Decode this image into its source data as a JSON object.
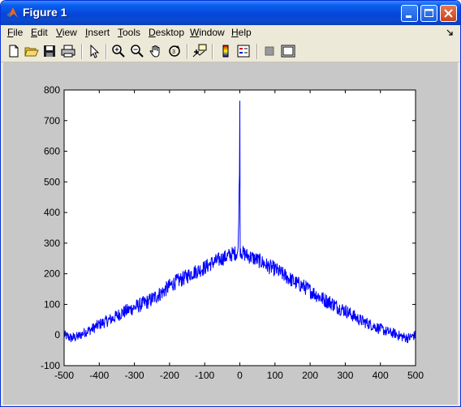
{
  "window": {
    "title": "Figure 1"
  },
  "menu": {
    "items": [
      {
        "key": "file",
        "label": "File",
        "accel": "F",
        "rest": "ile"
      },
      {
        "key": "edit",
        "label": "Edit",
        "accel": "E",
        "rest": "dit"
      },
      {
        "key": "view",
        "label": "View",
        "accel": "V",
        "rest": "iew"
      },
      {
        "key": "insert",
        "label": "Insert",
        "accel": "I",
        "rest": "nsert"
      },
      {
        "key": "tools",
        "label": "Tools",
        "accel": "T",
        "rest": "ools"
      },
      {
        "key": "desktop",
        "label": "Desktop",
        "accel": "D",
        "rest": "esktop"
      },
      {
        "key": "window",
        "label": "Window",
        "accel": "W",
        "rest": "indow"
      },
      {
        "key": "help",
        "label": "Help",
        "accel": "H",
        "rest": "elp"
      }
    ]
  },
  "toolbar": {
    "tools": [
      "new-figure-icon",
      "open-file-icon",
      "save-icon",
      "print-icon",
      "pointer-icon",
      "zoom-in-icon",
      "zoom-out-icon",
      "pan-hand-icon",
      "rotate-3d-icon",
      "data-cursor-icon",
      "colorbar-icon",
      "legend-icon",
      "hide-plot-tools-icon",
      "show-plot-tools-icon"
    ]
  },
  "chart_data": {
    "type": "line",
    "title": "",
    "xlabel": "",
    "ylabel": "",
    "xlim": [
      -500,
      500
    ],
    "ylim": [
      -100,
      800
    ],
    "xticks": [
      -500,
      -400,
      -300,
      -200,
      -100,
      0,
      100,
      200,
      300,
      400,
      500
    ],
    "yticks": [
      -100,
      0,
      100,
      200,
      300,
      400,
      500,
      600,
      700,
      800
    ],
    "grid": false,
    "series": [
      {
        "color": "#0000FF",
        "x": [
          -500,
          -480,
          -460,
          -440,
          -420,
          -400,
          -380,
          -360,
          -340,
          -320,
          -300,
          -280,
          -260,
          -240,
          -220,
          -200,
          -180,
          -160,
          -140,
          -120,
          -100,
          -80,
          -60,
          -40,
          -20,
          -5,
          -1,
          0,
          1,
          5,
          20,
          40,
          60,
          80,
          100,
          120,
          140,
          160,
          180,
          200,
          220,
          240,
          260,
          280,
          300,
          320,
          340,
          360,
          380,
          400,
          420,
          440,
          460,
          480,
          500
        ],
        "y": [
          0,
          -10,
          -5,
          10,
          20,
          35,
          45,
          55,
          70,
          80,
          90,
          100,
          110,
          125,
          140,
          160,
          175,
          185,
          200,
          210,
          220,
          235,
          245,
          255,
          265,
          270,
          525,
          765,
          280,
          270,
          260,
          250,
          240,
          225,
          215,
          200,
          185,
          170,
          160,
          145,
          130,
          115,
          105,
          90,
          80,
          65,
          50,
          40,
          30,
          20,
          10,
          5,
          -5,
          -10,
          0
        ],
        "noise_amplitude": 25
      }
    ]
  }
}
